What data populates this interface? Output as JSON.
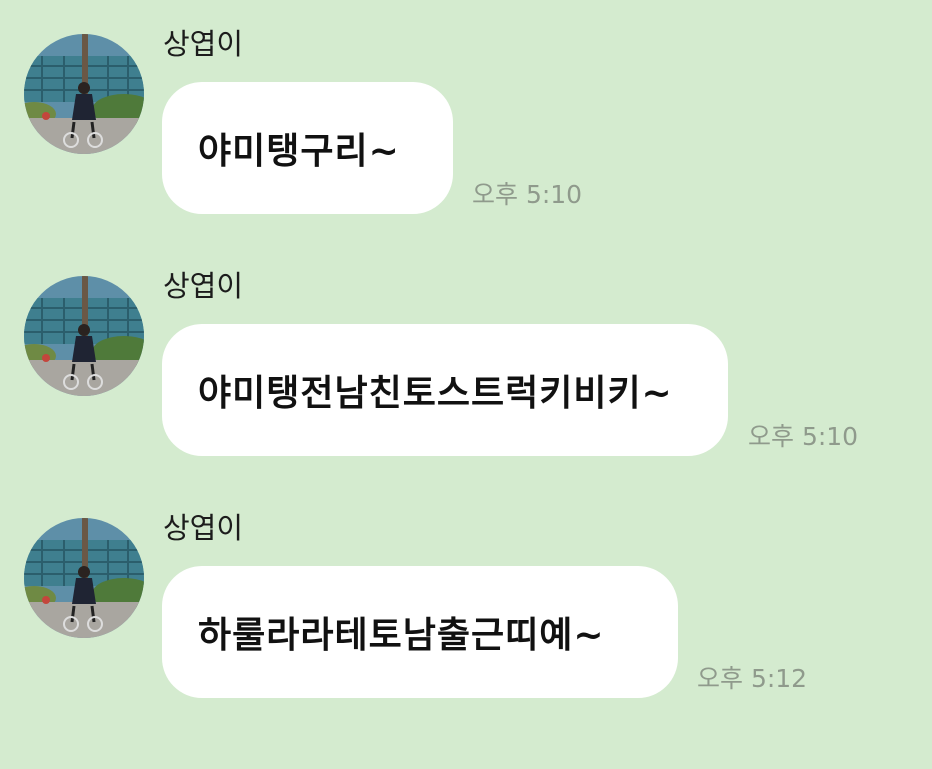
{
  "messages": [
    {
      "sender": "상엽이",
      "text": "야미탱구리~",
      "time": "오후 5:10"
    },
    {
      "sender": "상엽이",
      "text": "야미탱전남친토스트럭키비키~",
      "time": "오후 5:10"
    },
    {
      "sender": "상엽이",
      "text": "하룰라라테토남출근띠예~",
      "time": "오후 5:12"
    }
  ],
  "colors": {
    "background": "#d4ebcf",
    "bubble": "#ffffff",
    "timestamp": "#8f9a8c"
  },
  "icons": {
    "avatar": "profile-photo-cyclist"
  }
}
